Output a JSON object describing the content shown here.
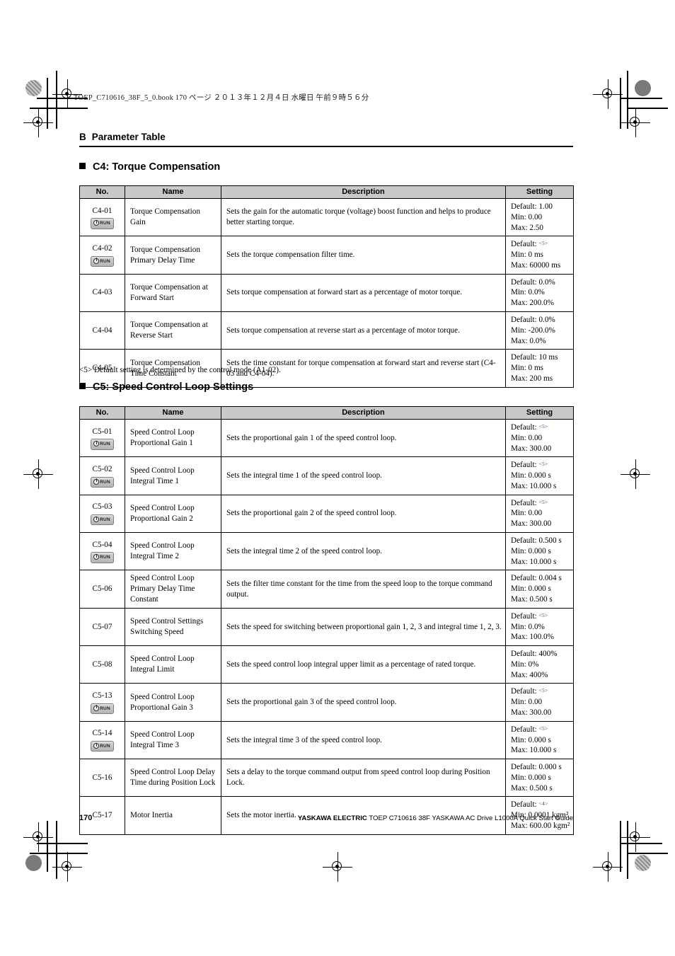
{
  "slug": "TOEP_C710616_38F_5_0.book   170 ページ   ２０１３年１２月４日   水曜日   午前９時５６分",
  "running_head": {
    "letter": "B",
    "title": "Parameter Table"
  },
  "columns": [
    "No.",
    "Name",
    "Description",
    "Setting"
  ],
  "sections": [
    {
      "heading": "C4: Torque Compensation",
      "rows": [
        {
          "no": "C4-01",
          "badge": "RUN",
          "name": "Torque Compensation Gain",
          "description": "Sets the gain for the automatic torque (voltage) boost function and helps to produce better starting torque.",
          "default": "Default: 1.00",
          "default_ref": "",
          "min": "Min: 0.00",
          "max": "Max: 2.50"
        },
        {
          "no": "C4-02",
          "badge": "RUN",
          "name": "Torque Compensation Primary Delay Time",
          "description": "Sets the torque compensation filter time.",
          "default": "Default:",
          "default_ref": "<5>",
          "min": "Min: 0 ms",
          "max": "Max: 60000 ms"
        },
        {
          "no": "C4-03",
          "badge": "",
          "name": "Torque Compensation at Forward Start",
          "description": "Sets torque compensation at forward start as a percentage of motor torque.",
          "default": "Default: 0.0%",
          "default_ref": "",
          "min": "Min: 0.0%",
          "max": "Max: 200.0%"
        },
        {
          "no": "C4-04",
          "badge": "",
          "name": "Torque Compensation at Reverse Start",
          "description": "Sets torque compensation at reverse start as a percentage of motor torque.",
          "default": "Default: 0.0%",
          "default_ref": "",
          "min": "Min: -200.0%",
          "max": "Max: 0.0%"
        },
        {
          "no": "C4-05",
          "badge": "",
          "name": "Torque Compensation Time Constant",
          "description": "Sets the time constant for torque compensation at forward start and reverse start (C4-03 and C4-04).",
          "default": "Default: 10 ms",
          "default_ref": "",
          "min": "Min: 0 ms",
          "max": "Max: 200 ms"
        }
      ]
    },
    {
      "heading": "C5: Speed Control Loop Settings",
      "rows": [
        {
          "no": "C5-01",
          "badge": "RUN",
          "name": "Speed Control Loop Proportional Gain 1",
          "description": "Sets the proportional gain 1 of the speed control loop.",
          "default": "Default:",
          "default_ref": "<5>",
          "min": "Min: 0.00",
          "max": "Max: 300.00"
        },
        {
          "no": "C5-02",
          "badge": "RUN",
          "name": "Speed Control Loop Integral Time 1",
          "description": "Sets the integral time 1 of the speed control loop.",
          "default": "Default:",
          "default_ref": "<5>",
          "min": "Min: 0.000 s",
          "max": "Max: 10.000 s"
        },
        {
          "no": "C5-03",
          "badge": "RUN",
          "name": "Speed Control Loop Proportional Gain 2",
          "description": "Sets the proportional gain 2 of the speed control loop.",
          "default": "Default:",
          "default_ref": "<5>",
          "min": "Min: 0.00",
          "max": "Max: 300.00"
        },
        {
          "no": "C5-04",
          "badge": "RUN",
          "name": "Speed Control Loop Integral Time 2",
          "description": "Sets the integral time 2 of the speed control loop.",
          "default": "Default: 0.500 s",
          "default_ref": "",
          "min": "Min: 0.000 s",
          "max": "Max: 10.000 s"
        },
        {
          "no": "C5-06",
          "badge": "",
          "name": "Speed Control Loop Primary Delay Time Constant",
          "description": "Sets the filter time constant for the time from the speed loop to the torque command output.",
          "default": "Default: 0.004 s",
          "default_ref": "",
          "min": "Min: 0.000 s",
          "max": "Max: 0.500 s"
        },
        {
          "no": "C5-07",
          "badge": "",
          "name": "Speed Control Settings Switching Speed",
          "description": "Sets the speed for switching between proportional gain 1, 2, 3 and integral time 1, 2, 3.",
          "default": "Default:",
          "default_ref": "<5>",
          "min": "Min: 0.0%",
          "max": "Max: 100.0%"
        },
        {
          "no": "C5-08",
          "badge": "",
          "name": "Speed Control Loop Integral Limit",
          "description": "Sets the speed control loop integral upper limit as a percentage of rated torque.",
          "default": "Default: 400%",
          "default_ref": "",
          "min": "Min: 0%",
          "max": "Max: 400%"
        },
        {
          "no": "C5-13",
          "badge": "RUN",
          "name": "Speed Control Loop Proportional Gain 3",
          "description": "Sets the proportional gain 3 of the speed control loop.",
          "default": "Default:",
          "default_ref": "<5>",
          "min": "Min: 0.00",
          "max": "Max: 300.00"
        },
        {
          "no": "C5-14",
          "badge": "RUN",
          "name": "Speed Control Loop Integral Time 3",
          "description": "Sets the integral time 3 of the speed control loop.",
          "default": "Default:",
          "default_ref": "<5>",
          "min": "Min: 0.000 s",
          "max": "Max: 10.000 s"
        },
        {
          "no": "C5-16",
          "badge": "",
          "name": "Speed Control Loop Delay Time during Position Lock",
          "description": "Sets a delay to the torque command output from speed control loop during Position Lock.",
          "default": "Default: 0.000 s",
          "default_ref": "",
          "min": "Min: 0.000 s",
          "max": "Max: 0.500 s"
        },
        {
          "no": "C5-17",
          "badge": "",
          "name": "Motor Inertia",
          "description": "Sets the motor inertia.",
          "default": "Default:",
          "default_ref": "<4>",
          "min": "Min: 0.0001 kgm²",
          "max": "Max: 600.00 kgm²"
        }
      ]
    }
  ],
  "footnote": "<5> Default setting is determined by the control mode (A1-02).",
  "footer": {
    "page_number": "170",
    "brand": "YASKAWA ELECTRIC",
    "doc_text": "TOEP C710616 38F YASKAWA AC Drive L1000A Quick Start Guide"
  }
}
